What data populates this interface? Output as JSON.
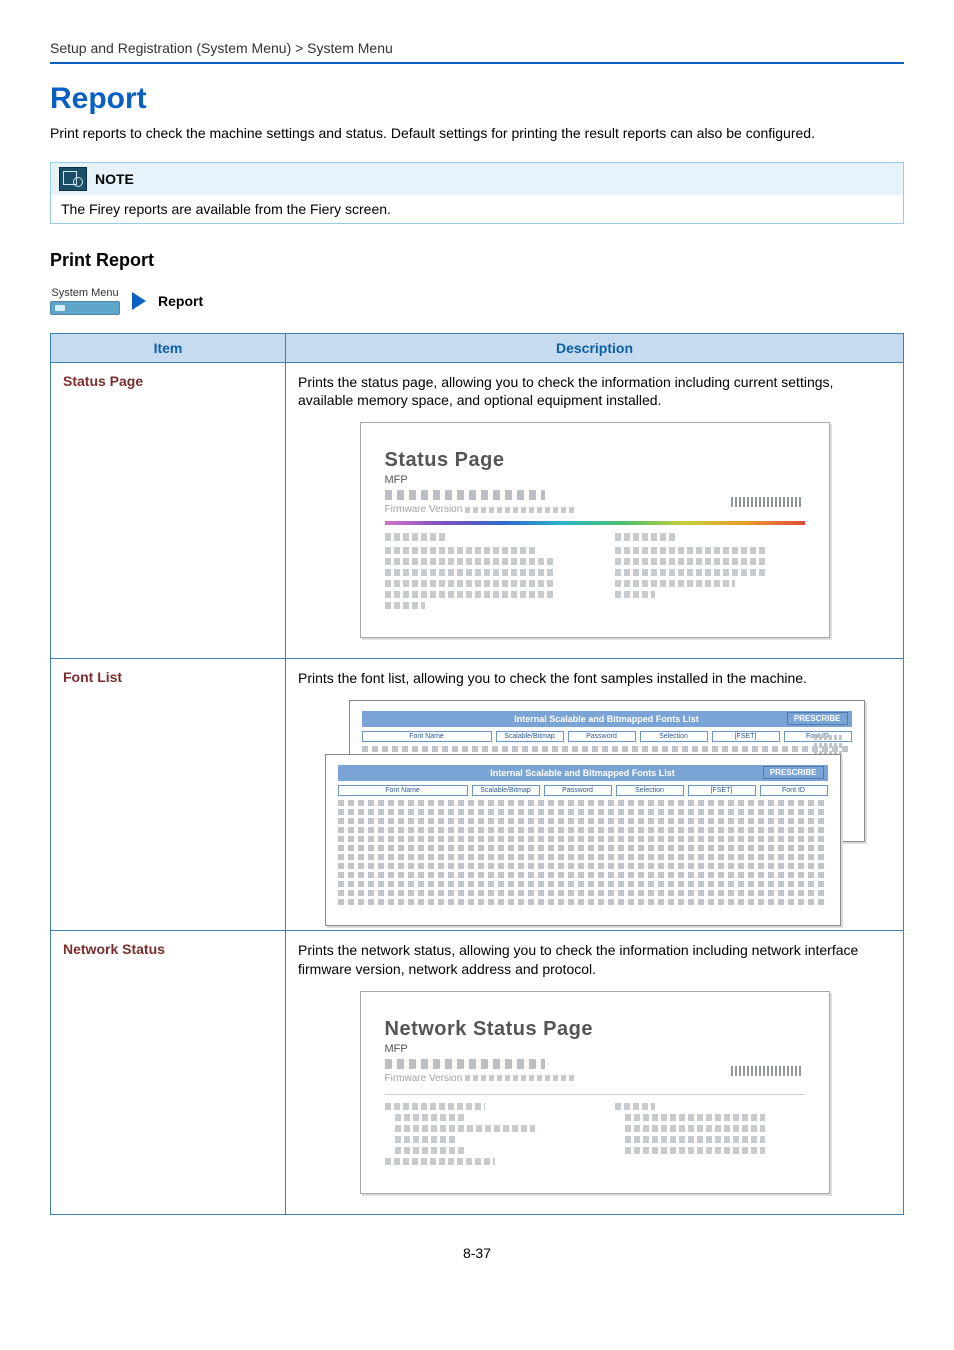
{
  "breadcrumb": "Setup and Registration (System Menu) > System Menu",
  "title": "Report",
  "intro": "Print reports to check the machine settings and status. Default settings for printing the result reports can also be configured.",
  "note": {
    "label": "NOTE",
    "text": "The Firey reports are available from the Fiery screen."
  },
  "section_heading": "Print Report",
  "nav": {
    "system_menu": "System Menu",
    "report": "Report"
  },
  "table": {
    "headers": {
      "item": "Item",
      "description": "Description"
    },
    "rows": [
      {
        "item": "Status Page",
        "desc": "Prints the status page, allowing you to check the information including current settings, available memory space, and optional equipment installed.",
        "preview": {
          "title": "Status Page",
          "sub": "MFP",
          "fw": "Firmware Version"
        }
      },
      {
        "item": "Font List",
        "desc": "Prints the font list, allowing you to check the font samples installed in the machine.",
        "preview": {
          "bar_title": "Internal Scalable and Bitmapped Fonts List",
          "badge": "PRESCRIBE",
          "cols": [
            "Font Name",
            "Scalable/Bitmap",
            "Password",
            "Selection",
            "[FSET]",
            "Font ID"
          ]
        }
      },
      {
        "item": "Network Status",
        "desc": "Prints the network status, allowing you to check the information including network interface firmware version, network address and protocol.",
        "preview": {
          "title": "Network Status Page",
          "sub": "MFP",
          "fw": "Firmware Version"
        }
      }
    ]
  },
  "page_number": "8-37"
}
